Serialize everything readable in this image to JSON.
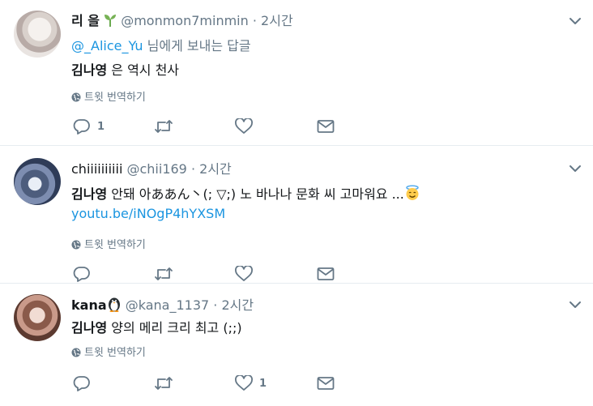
{
  "tweets": [
    {
      "name": "리 을",
      "handle": "@monmon7minmin",
      "dot": "·",
      "time": "2시간",
      "reply_to": {
        "mention": "@_Alice_Yu",
        "suffix": " 님에게 보내는 답글"
      },
      "text_bold": "김나영",
      "text_rest": " 은 역시 천사",
      "translate": "트윗 번역하기",
      "reply_count": "1",
      "like_count": ""
    },
    {
      "name": "chiiiiiiiiii",
      "handle": "@chii169",
      "dot": "·",
      "time": "2시간",
      "text_bold": "김나영",
      "text_rest": " 안돼 아ああん丶(; ▽;) 노 바나나 문화 씨 고마워요 ...",
      "link": "youtu.be/iNOgP4hYXSM",
      "translate": "트윗 번역하기",
      "reply_count": "",
      "like_count": ""
    },
    {
      "name": "kana",
      "handle": "@kana_1137",
      "dot": "·",
      "time": "2시간",
      "text_bold": "김나영",
      "text_rest": " 양의 메리 크리 최고 (;;)",
      "translate": "트윗 번역하기",
      "reply_count": "",
      "like_count": "1"
    }
  ],
  "colors": {
    "accent": "#1b95e0",
    "muted": "#657786",
    "icon": "#657786",
    "divider": "#e6ecf0"
  },
  "icons": [
    "sprout-icon",
    "angel-emoji-icon",
    "penguin-icon",
    "globe-icon",
    "reply-icon",
    "retweet-icon",
    "heart-icon",
    "envelope-icon",
    "chevron-down-icon"
  ]
}
